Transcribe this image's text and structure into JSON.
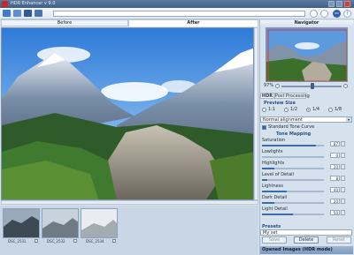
{
  "app": {
    "title": "HDR Enhancer v 9.0"
  },
  "toolbar": {
    "buttons": [
      "open-folder-icon",
      "open-file-icon",
      "save-icon",
      "batch-icon"
    ],
    "language": "EN",
    "help": "?"
  },
  "view_tabs": {
    "before": "Before",
    "after": "After"
  },
  "navigator": {
    "title": "Navigator",
    "zoom": "97%"
  },
  "panel_tabs": {
    "hdr": "HDR",
    "post": "Post Processing"
  },
  "preview_size": {
    "title": "Preview Size",
    "options": [
      "1:1",
      "1/2",
      "1/4",
      "1/8"
    ],
    "selected": "1/4"
  },
  "alignment": {
    "value": "Normal alignment"
  },
  "standard_tone_curve": {
    "label": "Standard Tone Curve",
    "checked": true
  },
  "tone_mapping": {
    "title": "Tone Mapping",
    "sliders": [
      {
        "label": "Saturation",
        "value": 87,
        "max": 100
      },
      {
        "label": "Lowlights",
        "value": 0,
        "max": 100
      },
      {
        "label": "Highlights",
        "value": 20,
        "max": 100
      },
      {
        "label": "Level of Detail",
        "value": 8,
        "max": 100
      },
      {
        "label": "Lightness",
        "value": 40,
        "max": 100
      },
      {
        "label": "Dark Detail",
        "value": 20,
        "max": 100
      },
      {
        "label": "Light Detail",
        "value": 50,
        "max": 100
      }
    ]
  },
  "presets": {
    "title": "Presets",
    "selected": "My set",
    "buttons": {
      "save": "Save",
      "delete": "Delete",
      "reset": "Reset"
    }
  },
  "opened_images": {
    "label": "Opened Images (HDR mode)"
  },
  "filmstrip": {
    "items": [
      {
        "label": "DSC_2531",
        "checked": true
      },
      {
        "label": "DSC_2532",
        "checked": true
      },
      {
        "label": "DSC_2534",
        "checked": true
      }
    ]
  },
  "colors": {
    "accent": "#2d5fb3",
    "panel": "#d6e1ee",
    "titlebar": "#3f5f86"
  }
}
